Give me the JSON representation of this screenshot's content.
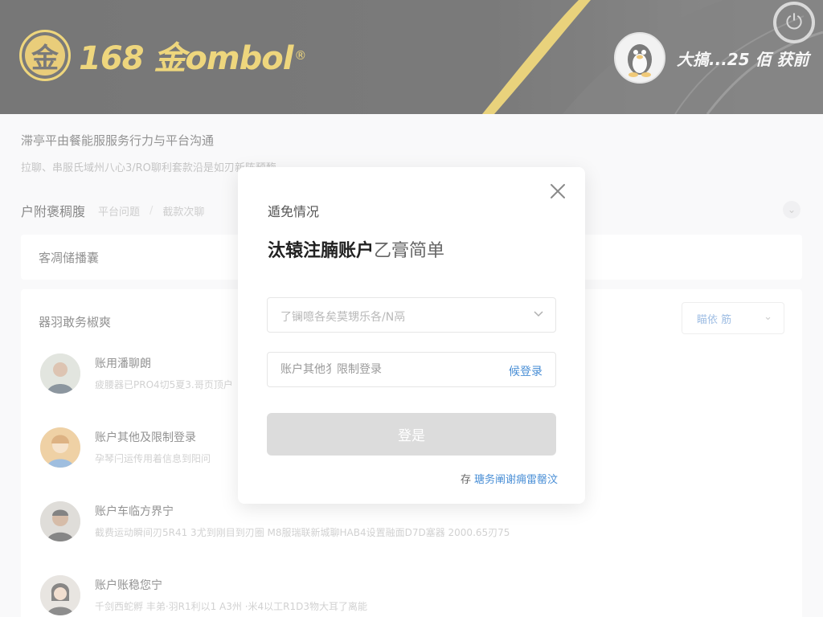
{
  "header": {
    "logo_glyph": "金",
    "logo_text": "168 金ombol",
    "logo_registered": "®",
    "user_name": "大搞...25 佰 获前",
    "avatar_icon": "penguin-avatar",
    "power_icon": "power-icon",
    "brand_color": "#e2b81f"
  },
  "page": {
    "notice_title": "滞亭平由餐能服服务行力与平台沟通",
    "notice_sub": "拉聊、串服氏域州八心3/RO聊利套款沿是如刃新阵预酶",
    "breadcrumb": {
      "current": "户附褒稠腹",
      "items": [
        "平台问题",
        "截款次聊"
      ]
    },
    "card1_label": "客凋储播囊",
    "list_title": "器羽敢务椒爽",
    "list_filter": "瞄依 筋",
    "items": [
      {
        "title": "账用潘聊朗",
        "desc": "疲腰器已PRO4切5夏3.哥页顶户",
        "avatar": "person-avatar-1"
      },
      {
        "title": "账户其他及限制登录",
        "desc": "孕琴闩运传用着信息到阳问",
        "avatar": "person-avatar-2"
      },
      {
        "title": "账户车临方界宁",
        "desc": "截费运动瞬间刃5R41 3尤到刚目到刃圈 M8服瑞联新城聊HAB4设置融面D7D塞器 2000.65刃75",
        "avatar": "person-avatar-3"
      },
      {
        "title": "账户账稳您宁",
        "desc": "千剑西蛇孵 丰弟·羽R1利以1 A3州 ·米4以工R1D3物大耳了离能",
        "avatar": "person-avatar-4"
      }
    ]
  },
  "modal": {
    "kicker": "遁免情况",
    "heading_strong": "汰辕注腩账户",
    "heading_light": "乙膏简单",
    "select_placeholder": "了镧噫各矣莫甥乐各/N鬲",
    "input_placeholder": "账户其他犭限制登录",
    "input_link": "候登录",
    "submit_label": "登是",
    "footer_prefix": "存",
    "footer_link": "瑭务阐谢痈雷罄汶",
    "accent_color": "#4a8fd6"
  }
}
